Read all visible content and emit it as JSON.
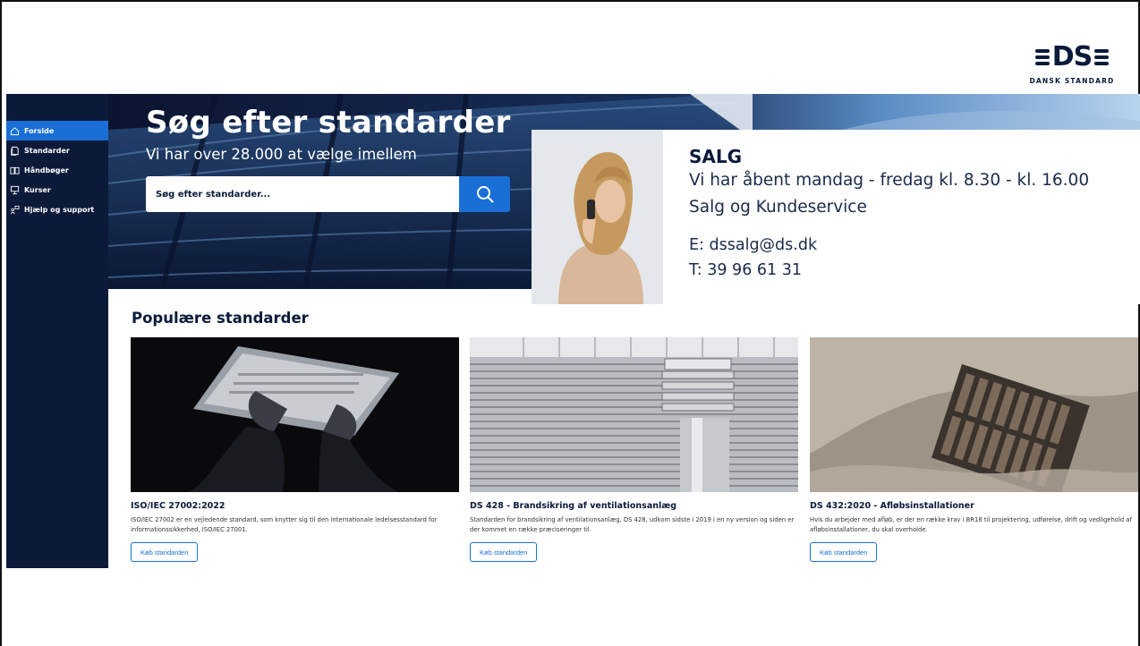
{
  "brand": {
    "logo_text": "DS",
    "logo_subtitle": "DANSK STANDARD"
  },
  "sidebar": {
    "items": [
      {
        "label": "Forside",
        "icon": "home-icon",
        "active": true
      },
      {
        "label": "Standarder",
        "icon": "document-icon",
        "active": false
      },
      {
        "label": "Håndbøger",
        "icon": "book-icon",
        "active": false
      },
      {
        "label": "Kurser",
        "icon": "presentation-icon",
        "active": false
      },
      {
        "label": "Hjælp og support",
        "icon": "support-icon",
        "active": false
      }
    ]
  },
  "hero": {
    "title": "Søg efter standarder",
    "subtitle": "Vi har over 28.000 at vælge imellem",
    "search_placeholder": "Søg efter standarder..."
  },
  "sales": {
    "title": "SALG",
    "hours": "Vi har åbent mandag - fredag kl. 8.30 - kl. 16.00",
    "department": "Salg og Kundeservice",
    "email": "E: dssalg@ds.dk",
    "phone": "T: 39 96 61 31"
  },
  "popular": {
    "heading": "Populære standarder",
    "cards": [
      {
        "title": "ISO/IEC 27002:2022",
        "description": "ISO/IEC 27002 er en vejledende standard, som knytter sig til den internationale ledelsesstandard for informationssikkerhed, ISO/IEC 27001.",
        "button": "Køb standarden"
      },
      {
        "title": "DS 428 - Brandsikring af ventilationsanlæg",
        "description": "Standarden for brandsikring af ventilationsanlæg, DS 428, udkom sidste i 2019 i en ny version og siden er der kommet en række præciseringer til.",
        "button": "Køb standarden"
      },
      {
        "title": "DS 432:2020 - Afløbsinstallationer",
        "description": "Hvis du arbejder med afløb, er der en række krav i BR18 til projektering, udførelse, drift og vedligehold af afløbsinstallationer, du skal overholde.",
        "button": "Køb standarden"
      }
    ]
  },
  "colors": {
    "navy": "#0c1a3a",
    "accent_blue": "#1a6fd6"
  }
}
